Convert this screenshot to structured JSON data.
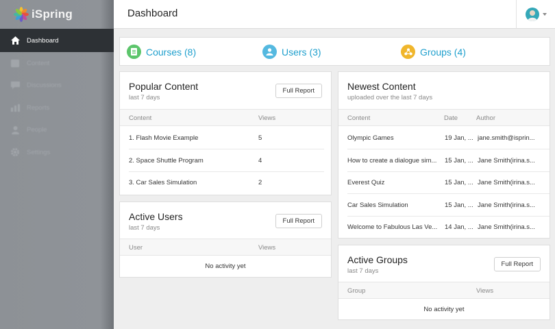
{
  "app": {
    "logo": "iSpring"
  },
  "sidebar": {
    "items": [
      {
        "label": "Dashboard",
        "icon": "home-icon"
      },
      {
        "label": "Content",
        "icon": "content-icon"
      },
      {
        "label": "Discussions",
        "icon": "chat-icon"
      },
      {
        "label": "Reports",
        "icon": "chart-icon"
      },
      {
        "label": "People",
        "icon": "person-icon"
      },
      {
        "label": "Settings",
        "icon": "gear-icon"
      }
    ]
  },
  "header": {
    "title": "Dashboard"
  },
  "stats": [
    {
      "label": "Courses (8)",
      "color": "#5cc56b",
      "icon": "courses-icon"
    },
    {
      "label": "Users (3)",
      "color": "#55b9e0",
      "icon": "user-icon"
    },
    {
      "label": "Groups (4)",
      "color": "#f0b62c",
      "icon": "groups-icon"
    }
  ],
  "popular": {
    "title": "Popular Content",
    "subtitle": "last 7 days",
    "button": "Full Report",
    "columns": [
      "Content",
      "Views"
    ],
    "rows": [
      {
        "content": "1. Flash Movie Example",
        "views": "5"
      },
      {
        "content": "2. Space Shuttle Program",
        "views": "4"
      },
      {
        "content": "3. Car Sales Simulation",
        "views": "2"
      }
    ]
  },
  "active_users": {
    "title": "Active Users",
    "subtitle": "last 7 days",
    "button": "Full Report",
    "columns": [
      "User",
      "Views"
    ],
    "empty": "No activity yet"
  },
  "newest": {
    "title": "Newest Content",
    "subtitle": "uploaded over the last 7 days",
    "columns": [
      "Content",
      "Date",
      "Author"
    ],
    "rows": [
      {
        "content": "Olympic Games",
        "date": "19 Jan, ...",
        "author": "jane.smith@isprin..."
      },
      {
        "content": "How to create a dialogue sim...",
        "date": "15 Jan, ...",
        "author": "Jane Smith(irina.s..."
      },
      {
        "content": "Everest Quiz",
        "date": "15 Jan, ...",
        "author": "Jane Smith(irina.s..."
      },
      {
        "content": "Car Sales Simulation",
        "date": "15 Jan, ...",
        "author": "Jane Smith(irina.s..."
      },
      {
        "content": "Welcome to Fabulous Las Ve...",
        "date": "14 Jan, ...",
        "author": "Jane Smith(irina.s..."
      }
    ]
  },
  "active_groups": {
    "title": "Active Groups",
    "subtitle": "last 7 days",
    "button": "Full Report",
    "columns": [
      "Group",
      "Views"
    ],
    "empty": "No activity yet"
  },
  "colors": {
    "accent": "#1e9fcd",
    "sidebar_active": "#2d3135"
  }
}
